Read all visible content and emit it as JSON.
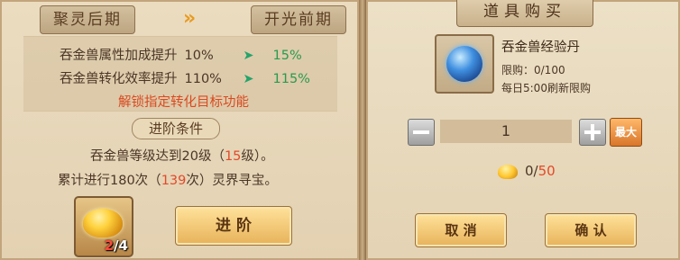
{
  "left_panel": {
    "current_stage": "聚灵后期",
    "next_stage": "开光前期",
    "arrows": "»",
    "stats": [
      {
        "label": "吞金兽属性加成提升",
        "current": "10%",
        "next": "15%"
      },
      {
        "label": "吞金兽转化效率提升",
        "current": "110%",
        "next": "115%"
      }
    ],
    "chevron": "➤",
    "unlock_text": "解锁指定转化目标功能",
    "conditions_title": "进阶条件",
    "condition_1": {
      "pre": "吞金兽等级达到20级（",
      "value": "15",
      "post": "级）。"
    },
    "condition_2": {
      "pre": "累计进行180次（",
      "value": "139",
      "post": "次）灵界寻宝。"
    },
    "item": {
      "have": "2",
      "sep_need": "/4",
      "icon": "gold-ingot-icon"
    },
    "advance_button": "进 阶"
  },
  "shop": {
    "title": "道具购买",
    "item_name": "吞金兽经验丹",
    "limit": "限购：0/100",
    "refresh": "每日5:00刷新限购",
    "item_icon": "blue-orb-icon",
    "quantity": "1",
    "max_label": "最大",
    "price_have": "0",
    "price_sep": "/",
    "price_cost": "50",
    "cancel_label": "取 消",
    "confirm_label": "确 认"
  }
}
